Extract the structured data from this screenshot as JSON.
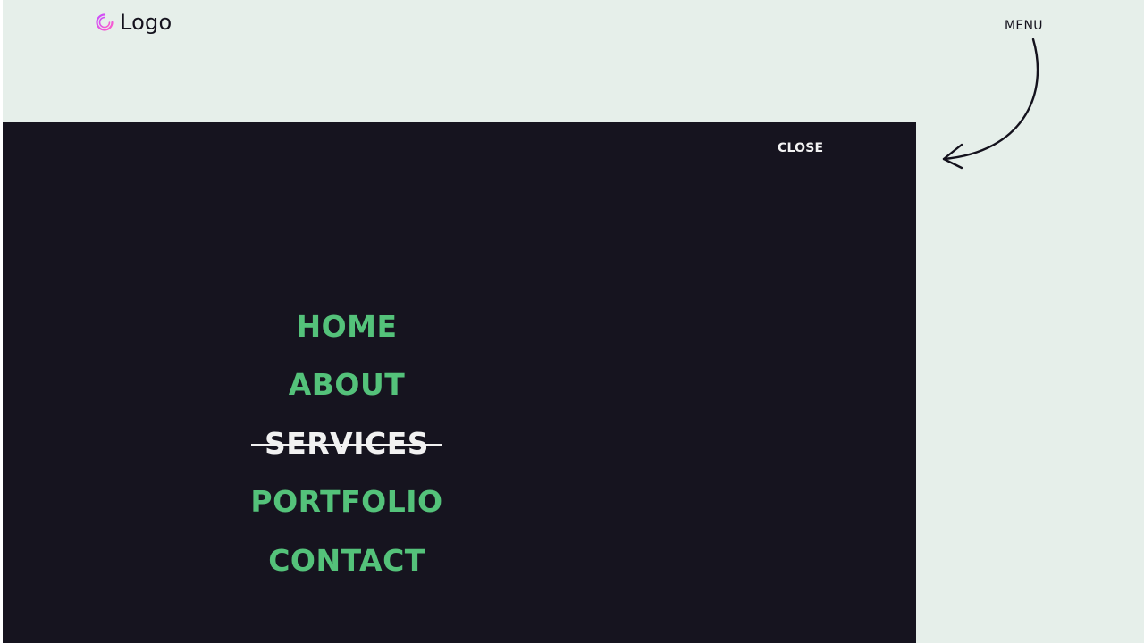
{
  "header": {
    "logo_text": "Logo",
    "logo_icon": "logo-ring-icon",
    "menu_label": "MENU"
  },
  "overlay": {
    "close_label": "CLOSE",
    "nav_items": [
      {
        "label": "HOME",
        "active": false
      },
      {
        "label": "ABOUT",
        "active": false
      },
      {
        "label": "SERVICES",
        "active": true
      },
      {
        "label": "PORTFOLIO",
        "active": false
      },
      {
        "label": "CONTACT",
        "active": false
      }
    ]
  },
  "colors": {
    "page_background": "#e6efea",
    "overlay_background": "#16141f",
    "nav_accent": "#54c27a",
    "nav_active": "#f1f1f1",
    "logo_gradient_start": "#c84bff",
    "logo_gradient_end": "#ff5fc8"
  }
}
